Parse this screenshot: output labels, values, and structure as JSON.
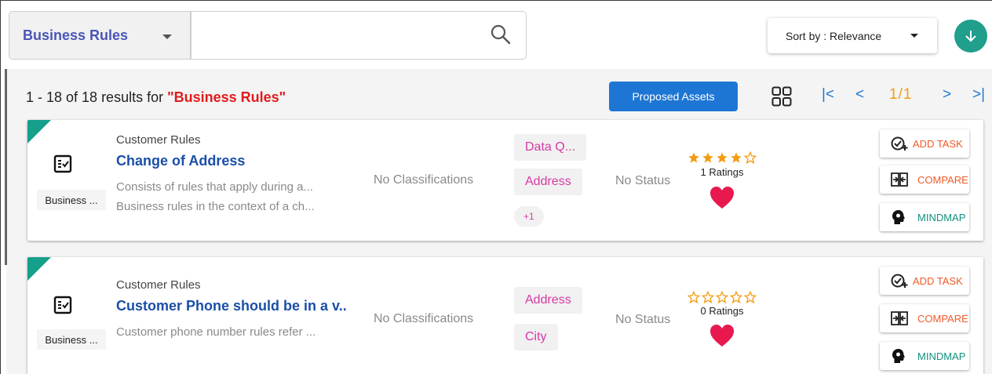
{
  "search": {
    "type_selected": "Business Rules",
    "query_value": "",
    "sort_label": "Sort by : Relevance"
  },
  "results": {
    "count_text": "1 - 18 of 18 results for ",
    "query_text": "\"Business Rules\"",
    "proposed_label": "Proposed Assets",
    "pager_first": "|<",
    "pager_prev": "<",
    "page": "1/1",
    "pager_next": ">",
    "pager_last": ">|"
  },
  "cards": [
    {
      "asset_type": "Business ...",
      "category": "Customer Rules",
      "title": "Change of Address",
      "desc1": "Consists of rules that apply during a...",
      "desc2": "Business rules in the context of a ch...",
      "classification": "No Classifications",
      "tags": [
        "Data Q...",
        "Address",
        "+1"
      ],
      "status": "No Status",
      "stars": 4.5,
      "ratings": "1 Ratings",
      "actions": {
        "task": "ADD TASK",
        "compare": "COMPARE",
        "mindmap": "MINDMAP"
      }
    },
    {
      "asset_type": "Business ...",
      "category": "Customer Rules",
      "title": "Customer Phone should be in a v..",
      "desc1": "Customer phone number rules refer ...",
      "desc2": "",
      "classification": "No Classifications",
      "tags": [
        "Address",
        "City"
      ],
      "status": "No Status",
      "stars": 0,
      "ratings": "0 Ratings",
      "actions": {
        "task": "ADD TASK",
        "compare": "COMPARE",
        "mindmap": "MINDMAP"
      }
    }
  ],
  "colors": {
    "accent_teal": "#15a08b",
    "brand_blue": "#1e76d4",
    "tag_pink": "#d63aa3",
    "star_orange": "#f39c12",
    "heart_red": "#e8194f",
    "action_orange": "#f05a28"
  },
  "icons": {
    "type_caret": "chevron-down-icon",
    "search": "search-icon",
    "download": "arrow-down-icon",
    "grid": "grid-view-icon",
    "asset": "checklist-icon",
    "heart": "heart-icon",
    "task": "add-task-icon",
    "compare": "compare-icon",
    "mindmap": "mindmap-icon"
  }
}
